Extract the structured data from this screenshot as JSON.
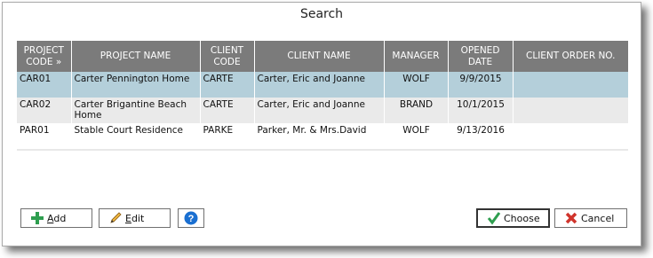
{
  "dialog": {
    "title": "Search"
  },
  "grid": {
    "headers": [
      {
        "line1": "PROJECT",
        "line2": "CODE »"
      },
      {
        "line1": "PROJECT NAME",
        "line2": ""
      },
      {
        "line1": "CLIENT",
        "line2": "CODE"
      },
      {
        "line1": "CLIENT NAME",
        "line2": ""
      },
      {
        "line1": "MANAGER",
        "line2": ""
      },
      {
        "line1": "OPENED",
        "line2": "DATE"
      },
      {
        "line1": "CLIENT ORDER NO.",
        "line2": ""
      }
    ],
    "rows": [
      {
        "project_code": "CAR01",
        "project_name": "Carter Pennington Home",
        "client_code": "CARTE",
        "client_name": "Carter, Eric and Joanne",
        "manager": "WOLF",
        "opened": "9/9/2015",
        "order_no": ""
      },
      {
        "project_code": "CAR02",
        "project_name": "Carter Brigantine Beach Home",
        "client_code": "CARTE",
        "client_name": "Carter, Eric and Joanne",
        "manager": "BRAND",
        "opened": "10/1/2015",
        "order_no": ""
      },
      {
        "project_code": "PAR01",
        "project_name": "Stable Court Residence",
        "client_code": "PARKE",
        "client_name": "Parker, Mr. & Mrs.David",
        "manager": "WOLF",
        "opened": "9/13/2016",
        "order_no": ""
      }
    ],
    "selected_row_color": "#b4cfda",
    "header_color": "#7b7b7b"
  },
  "buttons": {
    "add": {
      "hotkey": "A",
      "rest": "dd",
      "icon": "plus-icon"
    },
    "edit": {
      "hotkey": "E",
      "rest": "dit",
      "icon": "pencil-icon"
    },
    "help": {
      "icon": "help-icon"
    },
    "choose": {
      "label": "Choose",
      "icon": "checkmark-icon"
    },
    "cancel": {
      "label": "Cancel",
      "icon": "x-icon"
    }
  }
}
